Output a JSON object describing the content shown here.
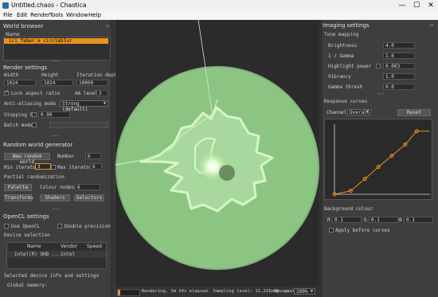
{
  "window": {
    "title": "Untitled.chaos - Chaotica",
    "minimize": "—",
    "maximize": "☐",
    "close": "✕"
  },
  "menu": [
    "File",
    "Edit",
    "Render",
    "Tools",
    "Window",
    "Help"
  ],
  "world_browser": {
    "title": "World browser",
    "header": "Name",
    "selected_item": "ici_faber_e_circleblur"
  },
  "render_settings": {
    "title": "Render settings",
    "width_label": "Width",
    "height_label": "Height",
    "depth_label": "Iteration depth",
    "width": "1024",
    "height": "1024",
    "depth": "10000",
    "lock_aspect_label": "Lock aspect ratio",
    "lock_aspect": true,
    "aa_level_label": "AA level",
    "aa_level": "2",
    "aa_mode_label": "Anti-aliasing mode",
    "aa_mode": "Strong (default)",
    "stopping_sl_label": "Stopping SL",
    "stopping_sl": "0.00",
    "batch_mode_label": "Batch mode"
  },
  "random_world": {
    "title": "Random world generator",
    "new_world_button": "New random world",
    "number_label": "Number",
    "number": "6",
    "min_iterators_label": "Min iterators",
    "min_iterators": "3",
    "max_iterators_label": "Max iterators",
    "max_iterators": "6",
    "partial_label": "Partial randomization",
    "palette_button": "Palette",
    "colour_nodes_label": "Colour nodes",
    "colour_nodes": "6",
    "transforms_button": "Transforms",
    "shaders_button": "Shaders",
    "selectors_button": "Selectors"
  },
  "opencl": {
    "title": "OpenCL settings",
    "use_opencl_label": "Use OpenCL",
    "double_precision_label": "Double precision",
    "device_selection_label": "Device selection",
    "columns": [
      "Name",
      "Vendor",
      "Speed"
    ],
    "rows": [
      {
        "name": "Intel(R) UHD ...",
        "vendor": "Intel",
        "speed": ""
      }
    ],
    "device_info_label": "Selected device info and settings",
    "global_memory_label": "Global memory:"
  },
  "status": {
    "progress": 0.12,
    "text": "Rendering, 3m 54s elapsed. Sampling level: 11.23, 8K spp",
    "image_scale_label": "Image scale:",
    "image_scale": "100%"
  },
  "imaging": {
    "title": "Imaging settings",
    "tone_mapping_label": "Tone mapping",
    "brightness_label": "Brightness",
    "brightness": "4.0",
    "gamma_label": "1 / Gamma",
    "gamma": "1.6",
    "highlight_label": "Highlight power",
    "highlight": "0.003",
    "vibrancy_label": "Vibrancy",
    "vibrancy": "1.0",
    "gamma_thresh_label": "Gamma thresh",
    "gamma_thresh": "0.0",
    "response_label": "Response curves",
    "channel_label": "Channel",
    "channel": "Overall",
    "reset_button": "Reset",
    "curve_points": [
      [
        0,
        0
      ],
      [
        0.17,
        0.05
      ],
      [
        0.32,
        0.22
      ],
      [
        0.46,
        0.39
      ],
      [
        0.6,
        0.55
      ],
      [
        0.74,
        0.71
      ],
      [
        0.86,
        0.9
      ],
      [
        1,
        0.9
      ]
    ],
    "background_label": "Background colour",
    "bg_r_label": "R",
    "bg_r": "0.1",
    "bg_g_label": "G",
    "bg_g": "0.1",
    "bg_b_label": "B",
    "bg_b": "0.1",
    "apply_before_curves_label": "Apply before curves"
  },
  "colors": {
    "accent": "#e8921f",
    "glow": "#9ed68c"
  }
}
